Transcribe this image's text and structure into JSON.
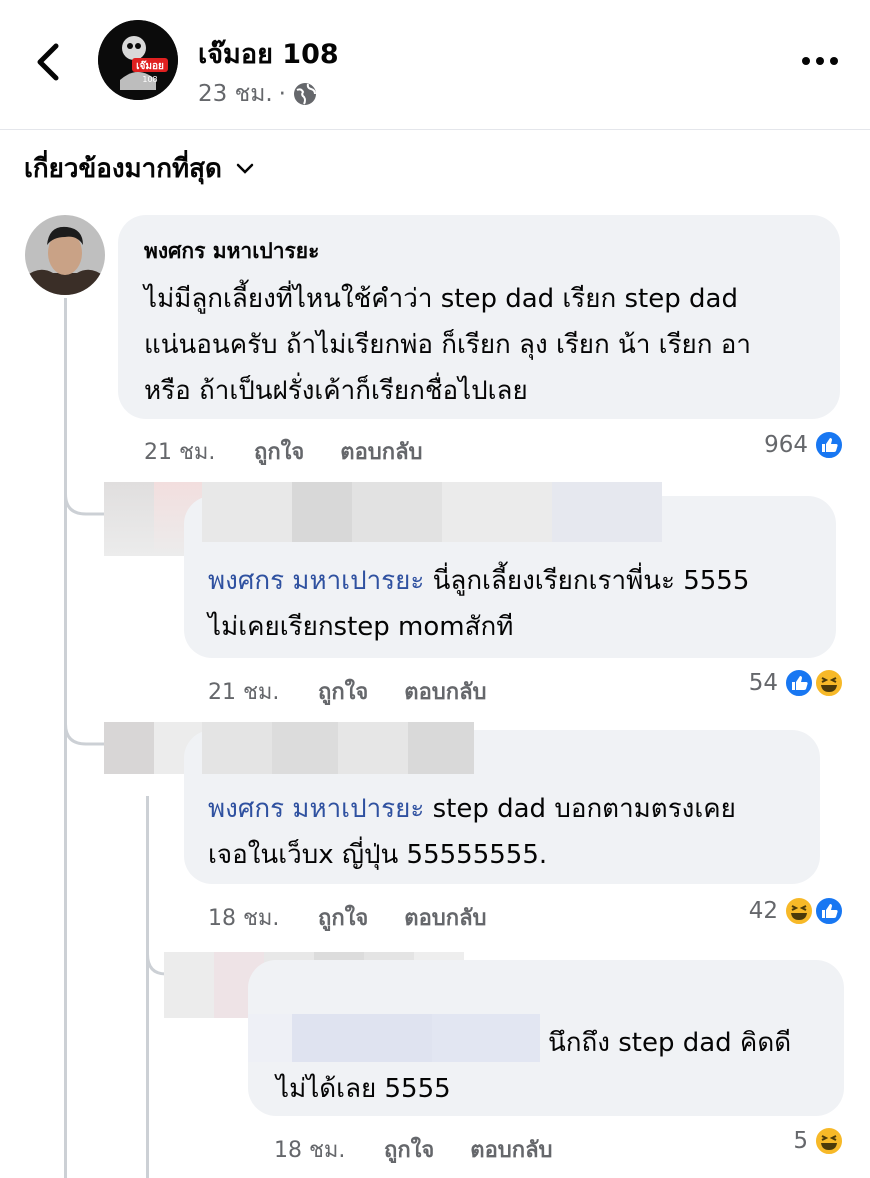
{
  "header": {
    "page_name": "เจ๊มอย 108",
    "post_time": "23 ชม.",
    "separator": "·",
    "logo_text": "เจ๊มอย",
    "logo_num": "108"
  },
  "sort": {
    "label": "เกี่ยวข้องมากที่สุด"
  },
  "comments": [
    {
      "name": "พงศกร มหาเปารยะ",
      "lines": [
        "ไม่มีลูกเลี้ยงที่ไหนใช้คำว่า step dad เรียก step dad",
        "แน่นอนครับ ถ้าไม่เรียกพ่อ ก็เรียก ลุง เรียก น้า เรียก อา",
        "หรือ ถ้าเป็นฝรั่งเค้าก็เรียกชื่อไปเลย"
      ],
      "time": "21 ชม.",
      "like": "ถูกใจ",
      "reply": "ตอบกลับ",
      "reaction_count": "964"
    },
    {
      "tag": "พงศกร มหาเปารยะ",
      "line1": " นี่ลูกเลี้ยงเรียกเราพี่นะ 5555",
      "line2": "ไม่เคยเรียกstep momสักที",
      "time": "21 ชม.",
      "like": "ถูกใจ",
      "reply": "ตอบกลับ",
      "reaction_count": "54"
    },
    {
      "tag": "พงศกร มหาเปารยะ",
      "line1": " step dad บอกตามตรงเคย",
      "line2": "เจอในเว็บx ญี่ปุ่น 55555555.",
      "time": "18 ชม.",
      "like": "ถูกใจ",
      "reply": "ตอบกลับ",
      "reaction_count": "42"
    },
    {
      "line1": "นึกถึง step dad คิดดี",
      "line2": "ไม่ได้เลย 5555",
      "time": "18 ชม.",
      "like": "ถูกใจ",
      "reply": "ตอบกลับ",
      "reaction_count": "5"
    }
  ],
  "colors": {
    "like_blue": "#1877f2",
    "tag_blue": "#2f51a0",
    "bubble": "#f0f2f5",
    "meta": "#65676b",
    "haha_yellow": "#f7b928"
  }
}
